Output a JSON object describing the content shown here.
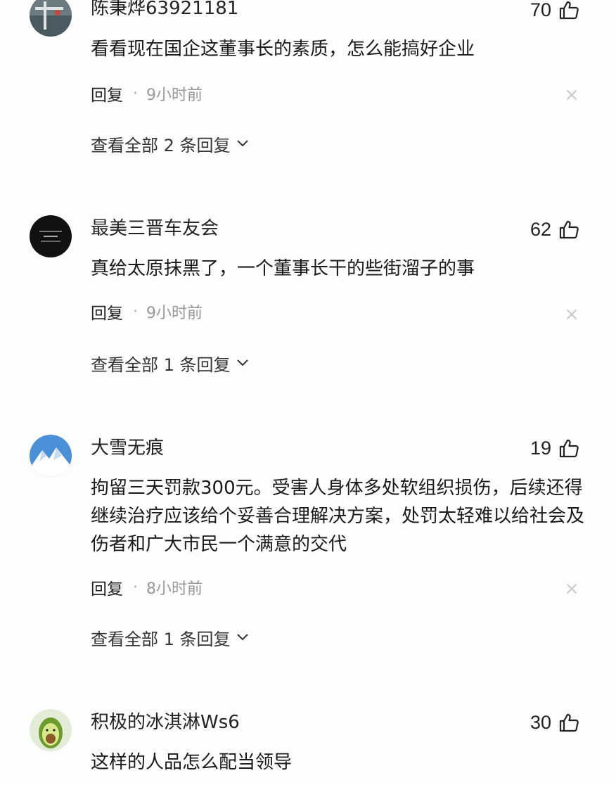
{
  "comments": [
    {
      "username": "陈秉烨63921181",
      "likes": "70",
      "text": "看看现在国企这董事长的素质，怎么能搞好企业",
      "reply_label": "回复",
      "dot": "·",
      "time": "9小时前",
      "view_all": "查看全部 2 条回复"
    },
    {
      "username": "最美三晋车友会",
      "likes": "62",
      "text": "真给太原抹黑了，一个董事长干的些街溜子的事",
      "reply_label": "回复",
      "dot": "·",
      "time": "9小时前",
      "view_all": "查看全部 1 条回复"
    },
    {
      "username": "大雪无痕",
      "likes": "19",
      "text": "拘留三天罚款300元。受害人身体多处软组织损伤，后续还得继续治疗应该给个妥善合理解决方案，处罚太轻难以给社会及伤者和广大市民一个满意的交代",
      "reply_label": "回复",
      "dot": "·",
      "time": "8小时前",
      "view_all": "查看全部 1 条回复"
    },
    {
      "username": "积极的冰淇淋Ws6",
      "likes": "30",
      "text": "这样的人品怎么配当领导"
    }
  ],
  "icons": {
    "like": "thumbs-up-icon",
    "close": "close-icon",
    "chevron": "chevron-down-icon"
  },
  "colors": {
    "text": "#222222",
    "meta": "#999999",
    "background": "#fdfdfd"
  }
}
